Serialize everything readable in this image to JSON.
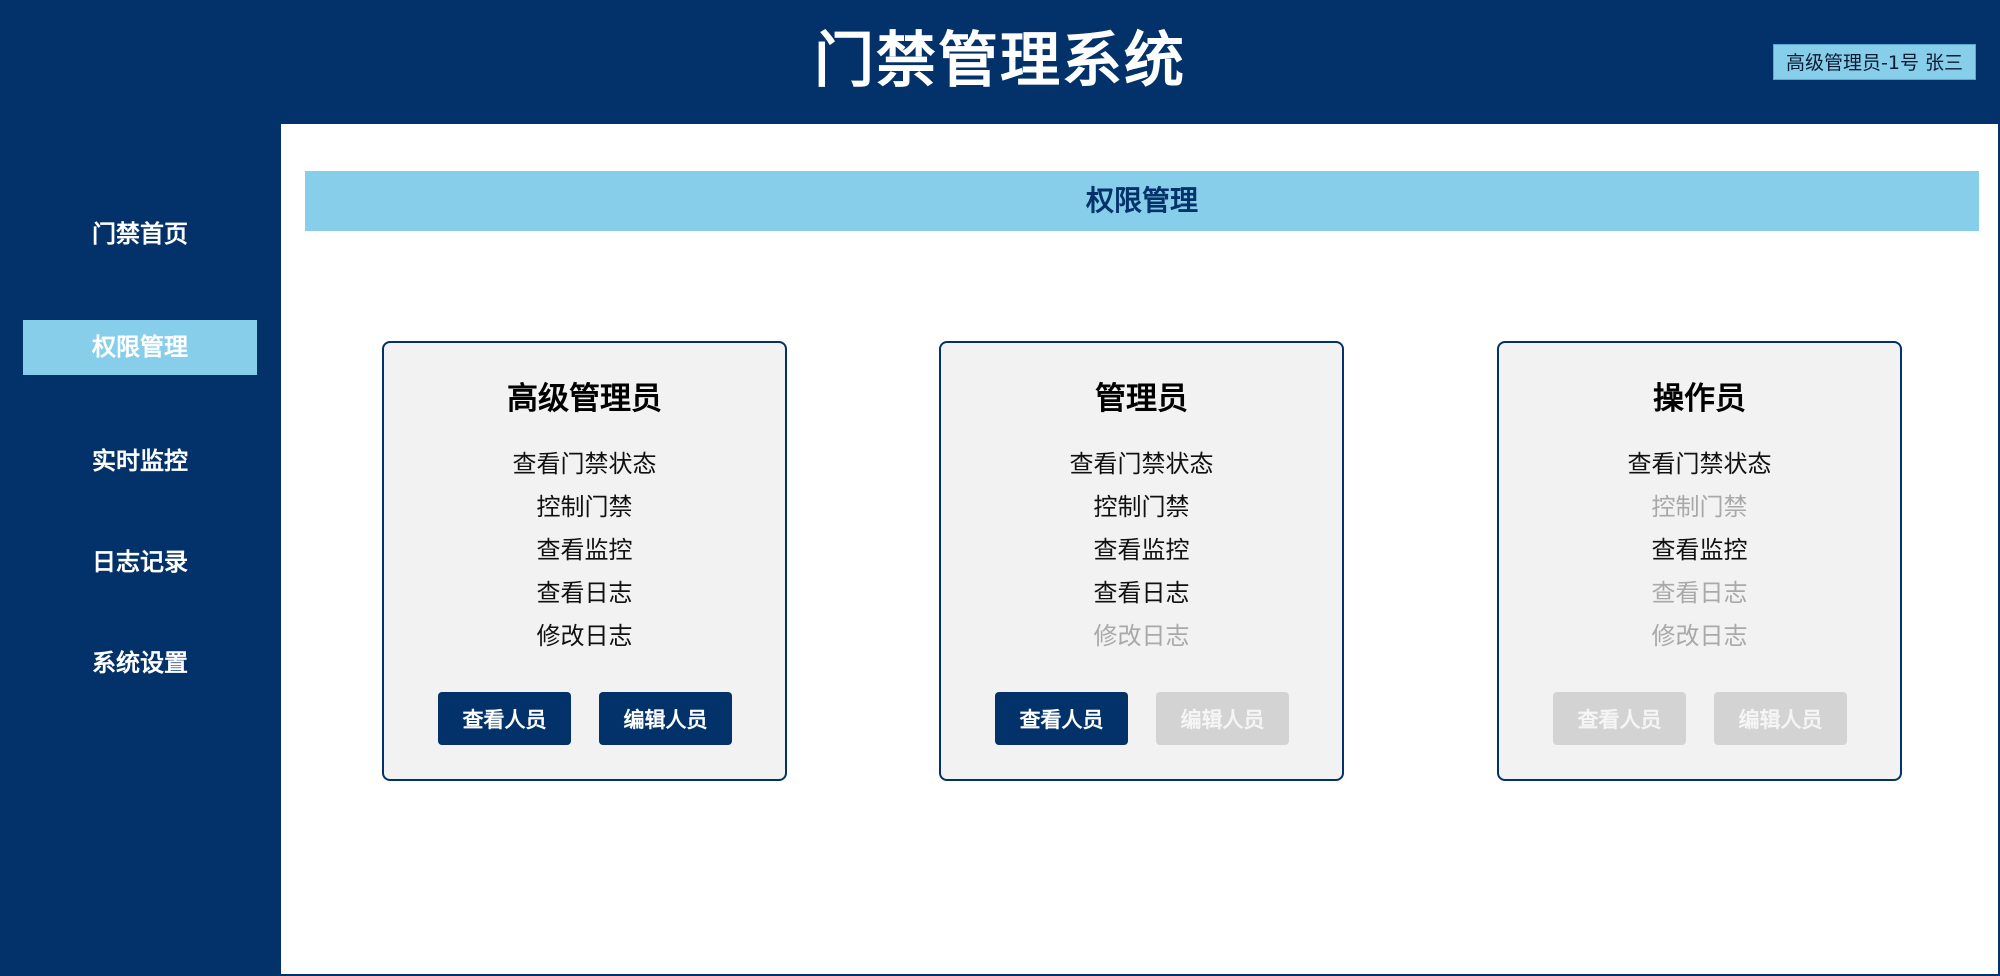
{
  "header": {
    "title": "门禁管理系统",
    "user": "高级管理员-1号 张三"
  },
  "sidebar": {
    "items": [
      {
        "label": "门禁首页",
        "active": false
      },
      {
        "label": "权限管理",
        "active": true
      },
      {
        "label": "实时监控",
        "active": false
      },
      {
        "label": "日志记录",
        "active": false
      },
      {
        "label": "系统设置",
        "active": false
      }
    ]
  },
  "main": {
    "section_title": "权限管理",
    "roles": [
      {
        "name": "高级管理员",
        "permissions": [
          {
            "label": "查看门禁状态",
            "enabled": true
          },
          {
            "label": "控制门禁",
            "enabled": true
          },
          {
            "label": "查看监控",
            "enabled": true
          },
          {
            "label": "查看日志",
            "enabled": true
          },
          {
            "label": "修改日志",
            "enabled": true
          }
        ],
        "buttons": [
          {
            "label": "查看人员",
            "enabled": true
          },
          {
            "label": "编辑人员",
            "enabled": true
          }
        ]
      },
      {
        "name": "管理员",
        "permissions": [
          {
            "label": "查看门禁状态",
            "enabled": true
          },
          {
            "label": "控制门禁",
            "enabled": true
          },
          {
            "label": "查看监控",
            "enabled": true
          },
          {
            "label": "查看日志",
            "enabled": true
          },
          {
            "label": "修改日志",
            "enabled": false
          }
        ],
        "buttons": [
          {
            "label": "查看人员",
            "enabled": true
          },
          {
            "label": "编辑人员",
            "enabled": false
          }
        ]
      },
      {
        "name": "操作员",
        "permissions": [
          {
            "label": "查看门禁状态",
            "enabled": true
          },
          {
            "label": "控制门禁",
            "enabled": false
          },
          {
            "label": "查看监控",
            "enabled": true
          },
          {
            "label": "查看日志",
            "enabled": false
          },
          {
            "label": "修改日志",
            "enabled": false
          }
        ],
        "buttons": [
          {
            "label": "查看人员",
            "enabled": false
          },
          {
            "label": "编辑人员",
            "enabled": false
          }
        ]
      }
    ]
  },
  "colors": {
    "primary": "#023269",
    "accent": "#87ceeb",
    "card_bg": "#f2f2f2",
    "disabled_text": "#a9a9a9",
    "disabled_button": "#d3d3d3"
  }
}
